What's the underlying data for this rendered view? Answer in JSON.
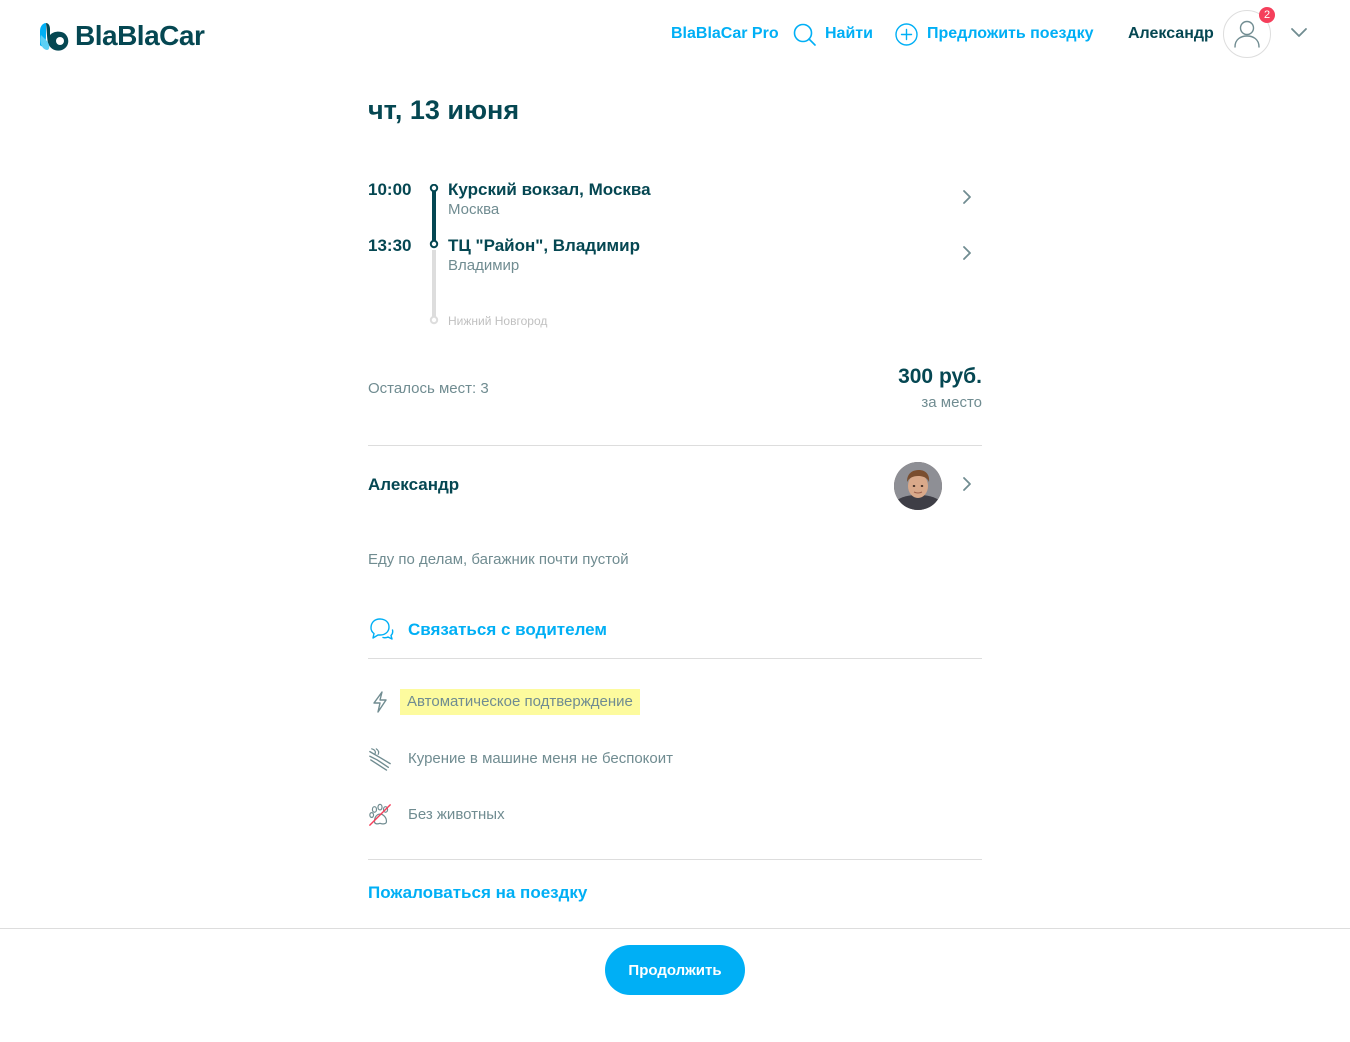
{
  "header": {
    "logo_text": "BlaBlaCar",
    "nav": {
      "pro": "BlaBlaCar Pro",
      "find": "Найти",
      "offer": "Предложить поездку"
    },
    "user_name": "Александр",
    "notification_count": "2",
    "icons": {
      "find": "search-icon",
      "offer": "plus-circle-icon",
      "avatar": "user-icon",
      "dropdown": "chevron-down-icon"
    }
  },
  "trip": {
    "date": "чт, 13 июня",
    "stops": [
      {
        "time": "10:00",
        "place": "Курский вокзал, Москва",
        "city": "Москва"
      },
      {
        "time": "13:30",
        "place": "ТЦ \"Район\", Владимир",
        "city": "Владимир"
      }
    ],
    "final_stop": "Нижний Новгород",
    "seats_left": "Осталось мест: 3",
    "price": "300 руб.",
    "price_unit": "за место"
  },
  "driver": {
    "name": "Александр",
    "note": "Еду по делам, багажник почти пустой",
    "contact_label": "Связаться с водителем"
  },
  "preferences": [
    {
      "icon": "lightning-icon",
      "label": "Автоматическое подтверждение",
      "highlighted": true
    },
    {
      "icon": "smoking-icon",
      "label": "Курение в машине меня не беспокоит",
      "highlighted": false
    },
    {
      "icon": "no-pets-icon",
      "label": "Без животных",
      "highlighted": false
    }
  ],
  "report_label": "Пожаловаться на поездку",
  "continue_label": "Продолжить",
  "colors": {
    "brand_blue": "#00aff5",
    "dark_text": "#054752",
    "muted_text": "#708c91",
    "highlight": "#fdfb9e",
    "badge": "#f53f5b",
    "divider": "#dddddd"
  }
}
